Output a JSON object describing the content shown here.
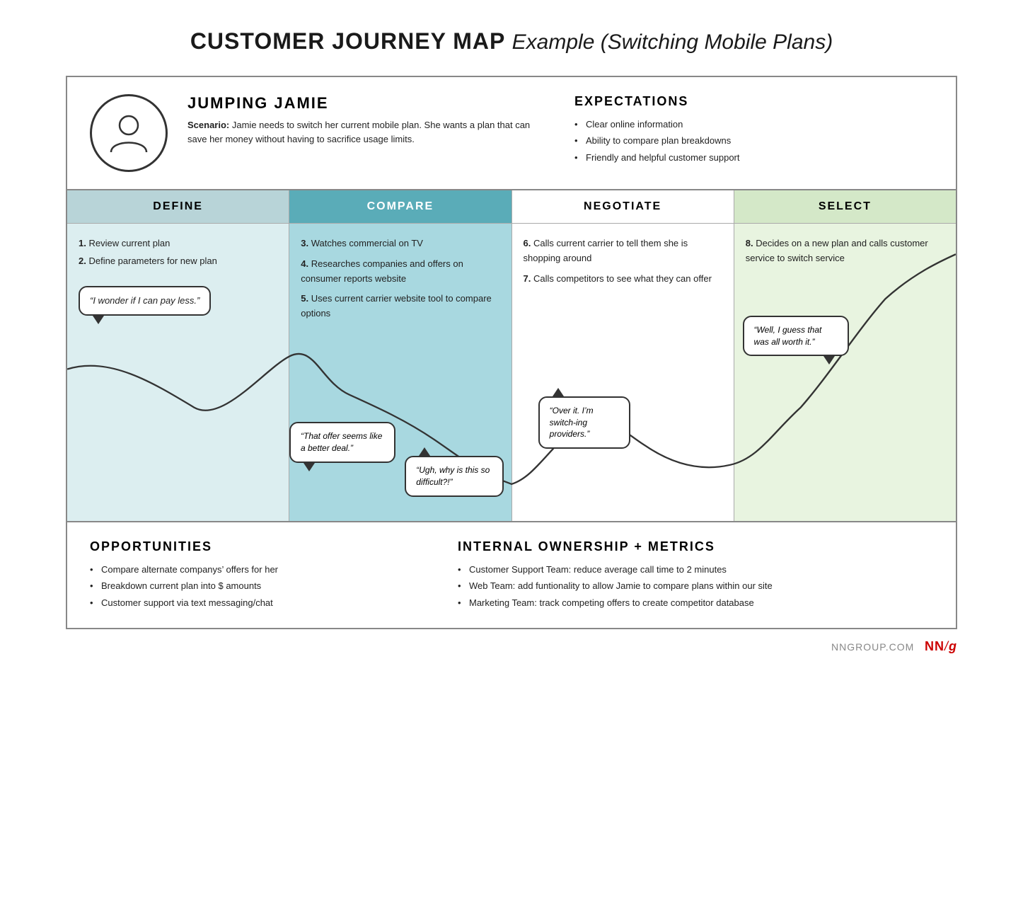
{
  "title": {
    "bold": "CUSTOMER JOURNEY MAP",
    "italic": "Example (Switching Mobile Plans)"
  },
  "persona": {
    "name": "JUMPING JAMIE",
    "scenario_label": "Scenario:",
    "scenario_text": "Jamie needs to switch her current mobile plan. She wants a plan that can save her money without having to sacrifice usage limits.",
    "expectations_title": "EXPECTATIONS",
    "expectations": [
      "Clear online information",
      "Ability to compare plan breakdowns",
      "Friendly and helpful customer support"
    ]
  },
  "phases": [
    {
      "id": "define",
      "label": "DEFINE",
      "actions": [
        {
          "num": "1.",
          "text": "Review current plan"
        },
        {
          "num": "2.",
          "text": "Define parameters for new plan"
        }
      ],
      "bubbles": [
        {
          "text": "“I wonder if I can pay less.”",
          "position": "mid-left"
        }
      ]
    },
    {
      "id": "compare",
      "label": "COMPARE",
      "actions": [
        {
          "num": "3.",
          "text": "Watches commercial on TV"
        },
        {
          "num": "4.",
          "text": "Researches companies and offers on consumer reports website"
        },
        {
          "num": "5.",
          "text": "Uses current carrier website tool to compare options"
        }
      ],
      "bubbles": [
        {
          "text": "“That offer seems like a better deal.”",
          "position": "mid"
        },
        {
          "text": "“Ugh, why is this so difficult?!”",
          "position": "bottom"
        }
      ]
    },
    {
      "id": "negotiate",
      "label": "NEGOTIATE",
      "actions": [
        {
          "num": "6.",
          "text": "Calls current carrier to tell them she is shopping around"
        },
        {
          "num": "7.",
          "text": "Calls competitors to see what they can offer"
        }
      ],
      "bubbles": [
        {
          "text": "“Over it. I’m switch-ing providers.”",
          "position": "mid"
        }
      ]
    },
    {
      "id": "select",
      "label": "SELECT",
      "actions": [
        {
          "num": "8.",
          "text": "Decides on a new plan and calls customer service to switch service"
        }
      ],
      "bubbles": [
        {
          "text": "“Well, I guess that was all worth it.”",
          "position": "mid"
        }
      ]
    }
  ],
  "opportunities": {
    "title": "OPPORTUNITIES",
    "items": [
      "Compare alternate companys’ offers for her",
      "Breakdown current plan into $ amounts",
      "Customer support via text messaging/chat"
    ]
  },
  "metrics": {
    "title": "INTERNAL OWNERSHIP + METRICS",
    "items": [
      "Customer Support Team: reduce average call time to 2 minutes",
      "Web Team: add funtionality to allow Jamie to compare plans within our site",
      "Marketing Team: track competing offers to create competitor database"
    ]
  },
  "branding": {
    "site": "NNGROUP.COM",
    "logo_nn": "NN",
    "logo_slash": "/",
    "logo_g": "g"
  }
}
